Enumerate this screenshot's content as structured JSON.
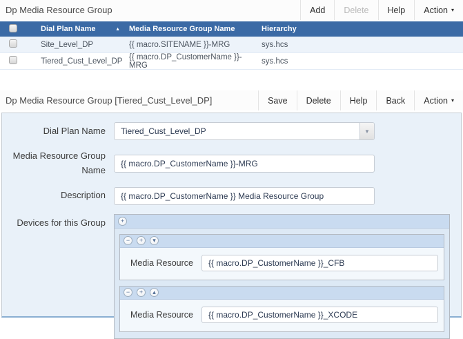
{
  "icons": {
    "caret_menu": "▾",
    "select_caret": "▼",
    "sort_asc": "▲",
    "plus": "+",
    "minus": "−",
    "move_down": "▾",
    "move_up": "▴"
  },
  "colors": {
    "table_header_blue": "#3b6aa5",
    "row_alt_blue": "#edf3fa",
    "form_bg_blue": "#e9f1f9",
    "strip_blue": "#c9dbf0",
    "form_bottom_line": "#8aaed2"
  },
  "list_panel": {
    "title": "Dp Media Resource Group",
    "toolbar": {
      "add": "Add",
      "delete": "Delete",
      "help": "Help",
      "action": "Action"
    },
    "table": {
      "columns": [
        "Dial Plan Name",
        "Media Resource Group Name",
        "Hierarchy"
      ],
      "sort_column": "Dial Plan Name",
      "sort_direction": "ascending",
      "rows": [
        {
          "dial_plan_name": "Site_Level_DP",
          "mrg_name": "{{ macro.SITENAME }}-MRG",
          "hierarchy": "sys.hcs"
        },
        {
          "dial_plan_name": "Tiered_Cust_Level_DP",
          "mrg_name": "{{ macro.DP_CustomerName }}-MRG",
          "hierarchy": "sys.hcs"
        }
      ]
    }
  },
  "detail_panel": {
    "title": "Dp Media Resource Group [Tiered_Cust_Level_DP]",
    "toolbar": {
      "save": "Save",
      "delete": "Delete",
      "help": "Help",
      "back": "Back",
      "action": "Action"
    },
    "fields": {
      "dial_plan_name": {
        "label": "Dial Plan Name",
        "value": "Tiered_Cust_Level_DP"
      },
      "mrg_name": {
        "label": "Media Resource Group Name",
        "value": "{{ macro.DP_CustomerName }}-MRG"
      },
      "description": {
        "label": "Description",
        "value": "{{ macro.DP_CustomerName }} Media Resource Group"
      },
      "devices": {
        "label": "Devices for this Group",
        "items": [
          {
            "label": "Media Resource",
            "value": "{{ macro.DP_CustomerName }}_CFB"
          },
          {
            "label": "Media Resource",
            "value": "{{ macro.DP_CustomerName }}_XCODE"
          }
        ]
      }
    }
  }
}
